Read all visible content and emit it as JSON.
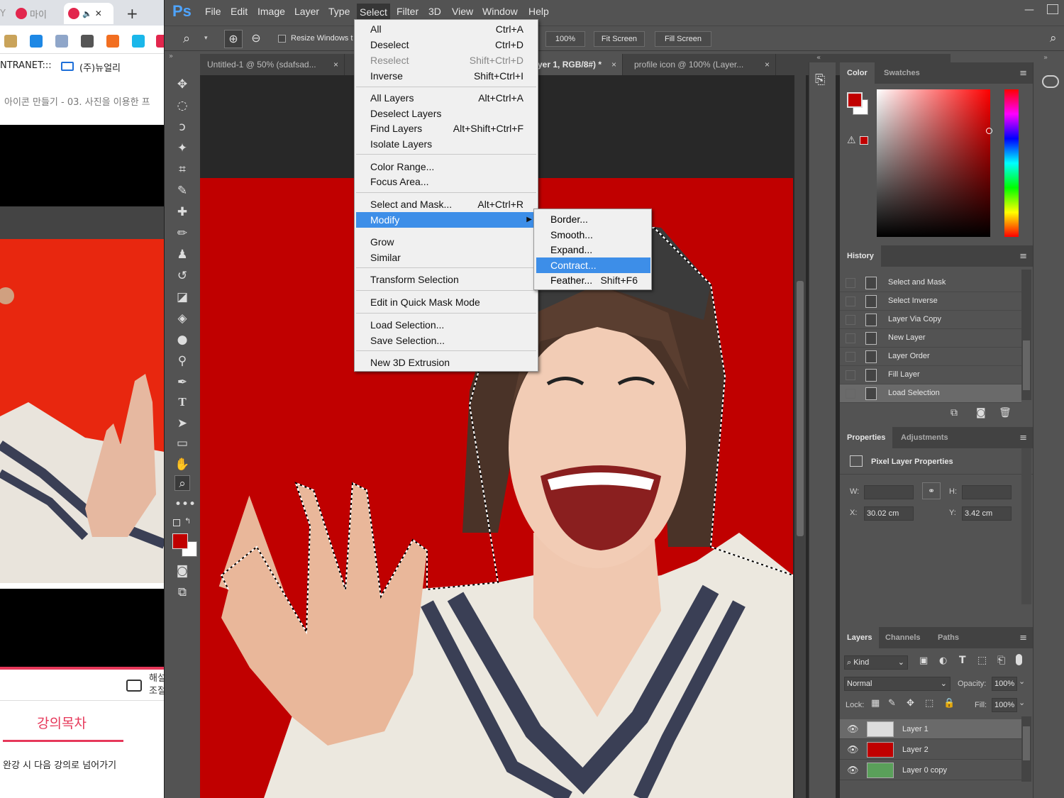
{
  "browser": {
    "tab1_label": "마이",
    "tab2_icons": "🔈",
    "tab2_close": "✕",
    "new_tab": "+",
    "row2_left": "NTRANET:::",
    "row2_right": "(주)뉴얼리",
    "page_title": "아이콘 만들기 - 03. 사진을 이용한 프",
    "caption_label": "해설\n조절",
    "lecture_tab": "강의목차",
    "next_text": "완강 시 다음 강의로 넘어가기"
  },
  "ps": {
    "logo": "Ps",
    "menus": [
      "File",
      "Edit",
      "Image",
      "Layer",
      "Type",
      "Select",
      "Filter",
      "3D",
      "View",
      "Window",
      "Help"
    ],
    "options": {
      "resize_windows": "Resize Windows t",
      "zoom_pct": "100%",
      "fit_screen": "Fit Screen",
      "fill_screen": "Fill Screen"
    },
    "doc_tabs": [
      {
        "label": "Untitled-1 @ 50% (sdafsad...",
        "close": "×"
      },
      {
        "label": "yer 1, RGB/8#) *",
        "close": "×"
      },
      {
        "label": "profile icon @ 100% (Layer...",
        "close": "×"
      }
    ],
    "select_menu": [
      {
        "label": "All",
        "shortcut": "Ctrl+A"
      },
      {
        "label": "Deselect",
        "shortcut": "Ctrl+D"
      },
      {
        "label": "Reselect",
        "shortcut": "Shift+Ctrl+D"
      },
      {
        "label": "Inverse",
        "shortcut": "Shift+Ctrl+I"
      },
      {
        "label": "All Layers",
        "shortcut": "Alt+Ctrl+A"
      },
      {
        "label": "Deselect Layers",
        "shortcut": ""
      },
      {
        "label": "Find Layers",
        "shortcut": "Alt+Shift+Ctrl+F"
      },
      {
        "label": "Isolate Layers",
        "shortcut": ""
      },
      {
        "label": "Color Range...",
        "shortcut": ""
      },
      {
        "label": "Focus Area...",
        "shortcut": ""
      },
      {
        "label": "Select and Mask...",
        "shortcut": "Alt+Ctrl+R"
      },
      {
        "label": "Modify",
        "shortcut": ""
      },
      {
        "label": "Grow",
        "shortcut": ""
      },
      {
        "label": "Similar",
        "shortcut": ""
      },
      {
        "label": "Transform Selection",
        "shortcut": ""
      },
      {
        "label": "Edit in Quick Mask Mode",
        "shortcut": ""
      },
      {
        "label": "Load Selection...",
        "shortcut": ""
      },
      {
        "label": "Save Selection...",
        "shortcut": ""
      },
      {
        "label": "New 3D Extrusion",
        "shortcut": ""
      }
    ],
    "modify_submenu": [
      {
        "label": "Border...",
        "shortcut": ""
      },
      {
        "label": "Smooth...",
        "shortcut": ""
      },
      {
        "label": "Expand...",
        "shortcut": ""
      },
      {
        "label": "Contract...",
        "shortcut": ""
      },
      {
        "label": "Feather...",
        "shortcut": "Shift+F6"
      }
    ],
    "color_panel": {
      "tab_color": "Color",
      "tab_swatches": "Swatches",
      "foreground": "#c00000",
      "background": "#ffffff"
    },
    "history": {
      "title": "History",
      "items": [
        "Select and Mask",
        "Select Inverse",
        "Layer Via Copy",
        "New Layer",
        "Layer Order",
        "Fill Layer",
        "Load Selection"
      ]
    },
    "properties": {
      "tab_properties": "Properties",
      "tab_adjustments": "Adjustments",
      "header": "Pixel Layer Properties",
      "w_label": "W:",
      "h_label": "H:",
      "x_label": "X:",
      "y_label": "Y:",
      "x_value": "30.02 cm",
      "y_value": "3.42 cm"
    },
    "layers": {
      "tab_layers": "Layers",
      "tab_channels": "Channels",
      "tab_paths": "Paths",
      "kind": "Kind",
      "blend_mode": "Normal",
      "opacity_label": "Opacity:",
      "opacity": "100%",
      "lock_label": "Lock:",
      "fill_label": "Fill:",
      "fill": "100%",
      "items": [
        "Layer 1",
        "Layer 2",
        "Layer 0 copy"
      ]
    }
  }
}
